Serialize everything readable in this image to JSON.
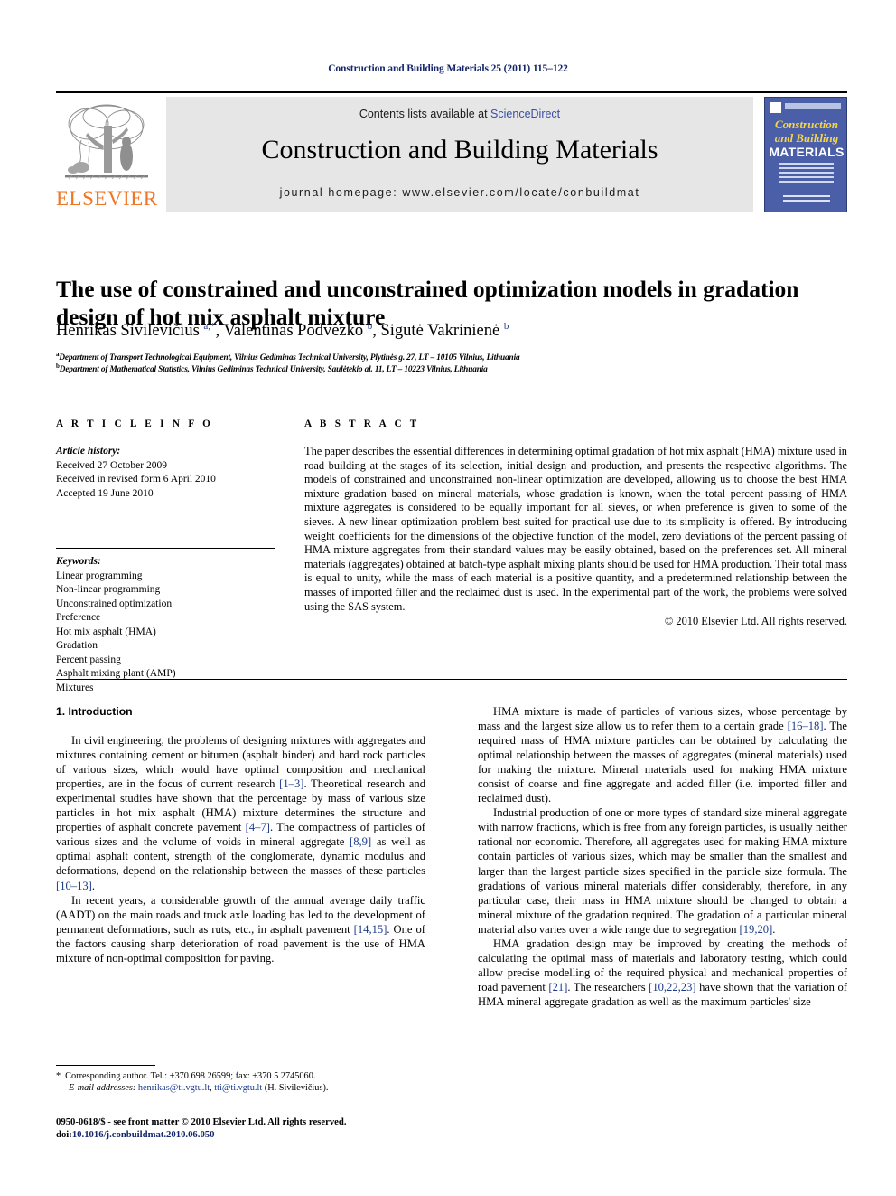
{
  "running_head": "Construction and Building Materials 25 (2011) 115–122",
  "masthead": {
    "publisher_name": "ELSEVIER",
    "contents_prefix": "Contents lists available at ",
    "sciencedirect": "ScienceDirect",
    "journal_name": "Construction and Building Materials",
    "homepage": "journal homepage: www.elsevier.com/locate/conbuildmat",
    "cover": {
      "line1": "Construction",
      "line2": "and Building",
      "line3": "MATERIALS"
    },
    "colors": {
      "elsevier_orange": "#ee7624",
      "link_blue": "#3a4fa0",
      "banner_gray": "#e6e6e6",
      "cover_blue": "#4a5fa8",
      "cover_yellow": "#f4d44a",
      "running_head_navy": "#14256b"
    }
  },
  "title": "The use of constrained and unconstrained optimization models in gradation design of hot mix asphalt mixture",
  "authors": {
    "a1_name": "Henrikas Sivilevičius ",
    "a1_sup": "a,",
    "a1_star": "*",
    "a2_name": ", Valentinas Podvezko ",
    "a2_sup": "b",
    "a3_name": ", Sigutė Vakrinienė ",
    "a3_sup": "b"
  },
  "affiliations": [
    {
      "marker": "a",
      "text": "Department of Transport Technological Equipment, Vilnius Gediminas Technical University, Plytinės g. 27, LT – 10105 Vilnius, Lithuania"
    },
    {
      "marker": "b",
      "text": "Department of Mathematical Statistics, Vilnius Gediminas Technical University, Saulėtekio al. 11, LT – 10223 Vilnius, Lithuania"
    }
  ],
  "article_info": {
    "heading": "A R T I C L E   I N F O",
    "history_title": "Article history:",
    "history": [
      "Received 27 October 2009",
      "Received in revised form 6 April 2010",
      "Accepted 19 June 2010"
    ],
    "keywords_title": "Keywords:",
    "keywords": [
      "Linear programming",
      "Non-linear programming",
      "Unconstrained optimization",
      "Preference",
      "Hot mix asphalt (HMA)",
      "Gradation",
      "Percent passing",
      "Asphalt mixing plant (AMP)",
      "Mixtures"
    ]
  },
  "abstract": {
    "heading": "A B S T R A C T",
    "text": "The paper describes the essential differences in determining optimal gradation of hot mix asphalt (HMA) mixture used in road building at the stages of its selection, initial design and production, and presents the respective algorithms. The models of constrained and unconstrained non-linear optimization are developed, allowing us to choose the best HMA mixture gradation based on mineral materials, whose gradation is known, when the total percent passing of HMA mixture aggregates is considered to be equally important for all sieves, or when preference is given to some of the sieves. A new linear optimization problem best suited for practical use due to its simplicity is offered. By introducing weight coefficients for the dimensions of the objective function of the model, zero deviations of the percent passing of HMA mixture aggregates from their standard values may be easily obtained, based on the preferences set. All mineral materials (aggregates) obtained at batch-type asphalt mixing plants should be used for HMA production. Their total mass is equal to unity, while the mass of each material is a positive quantity, and a predetermined relationship between the masses of imported filler and the reclaimed dust is used. In the experimental part of the work, the problems were solved using the SAS system.",
    "copyright": "© 2010 Elsevier Ltd. All rights reserved."
  },
  "body": {
    "section_heading": "1. Introduction",
    "left_paragraphs": [
      {
        "p1": "In civil engineering, the problems of designing mixtures with aggregates and mixtures containing cement or bitumen (asphalt binder) and hard rock particles of various sizes, which would have optimal composition and mechanical properties, are in the focus of current research ",
        "r1": "[1–3]",
        "p2": ". Theoretical research and experimental studies have shown that the percentage by mass of various size particles in hot mix asphalt (HMA) mixture determines the structure and properties of asphalt concrete pavement ",
        "r2": "[4–7]",
        "p3": ". The compactness of particles of various sizes and the volume of voids in mineral aggregate ",
        "r3": "[8,9]",
        "p4": " as well as optimal asphalt content, strength of the conglomerate, dynamic modulus and deformations, depend on the relationship between the masses of these particles ",
        "r4": "[10–13]",
        "p5": "."
      },
      {
        "p1": "In recent years, a considerable growth of the annual average daily traffic (AADT) on the main roads and truck axle loading has led to the development of permanent deformations, such as ruts, etc., in asphalt pavement ",
        "r1": "[14,15]",
        "p2": ". One of the factors causing sharp deterioration of road pavement is the use of HMA mixture of non-optimal composition for paving."
      }
    ],
    "right_paragraphs": [
      {
        "p1": "HMA mixture is made of particles of various sizes, whose percentage by mass and the largest size allow us to refer them to a certain grade ",
        "r1": "[16–18]",
        "p2": ". The required mass of HMA mixture particles can be obtained by calculating the optimal relationship between the masses of aggregates (mineral materials) used for making the mixture. Mineral materials used for making HMA mixture consist of coarse and fine aggregate and added filler (i.e. imported filler and reclaimed dust)."
      },
      {
        "p1": "Industrial production of one or more types of standard size mineral aggregate with narrow fractions, which is free from any foreign particles, is usually neither rational nor economic. Therefore, all aggregates used for making HMA mixture contain particles of various sizes, which may be smaller than the smallest and larger than the largest particle sizes specified in the particle size formula. The gradations of various mineral materials differ considerably, therefore, in any particular case, their mass in HMA mixture should be changed to obtain a mineral mixture of the gradation required. The gradation of a particular mineral material also varies over a wide range due to segregation ",
        "r1": "[19,20]",
        "p2": "."
      },
      {
        "p1": "HMA gradation design may be improved by creating the methods of calculating the optimal mass of materials and laboratory testing, which could allow precise modelling of the required physical and mechanical properties of road pavement ",
        "r1": "[21]",
        "p2": ". The researchers ",
        "r2": "[10,22,23]",
        "p3": " have shown that the variation of HMA mineral aggregate gradation as well as the maximum particles' size"
      }
    ]
  },
  "footnote": {
    "star": "*",
    "corresponding": "Corresponding author. Tel.: +370 698 26599; fax: +370 5 2745060.",
    "email_label": "E-mail addresses:",
    "email1": "henrikas@ti.vgtu.lt",
    "comma": ", ",
    "email2": "tti@ti.vgtu.lt",
    "email_suffix": " (H. Sivilevičius)."
  },
  "issn_line": {
    "text": "0950-0618/$ - see front matter © 2010 Elsevier Ltd. All rights reserved.",
    "doi_label": "doi:",
    "doi": "10.1016/j.conbuildmat.2010.06.050"
  }
}
